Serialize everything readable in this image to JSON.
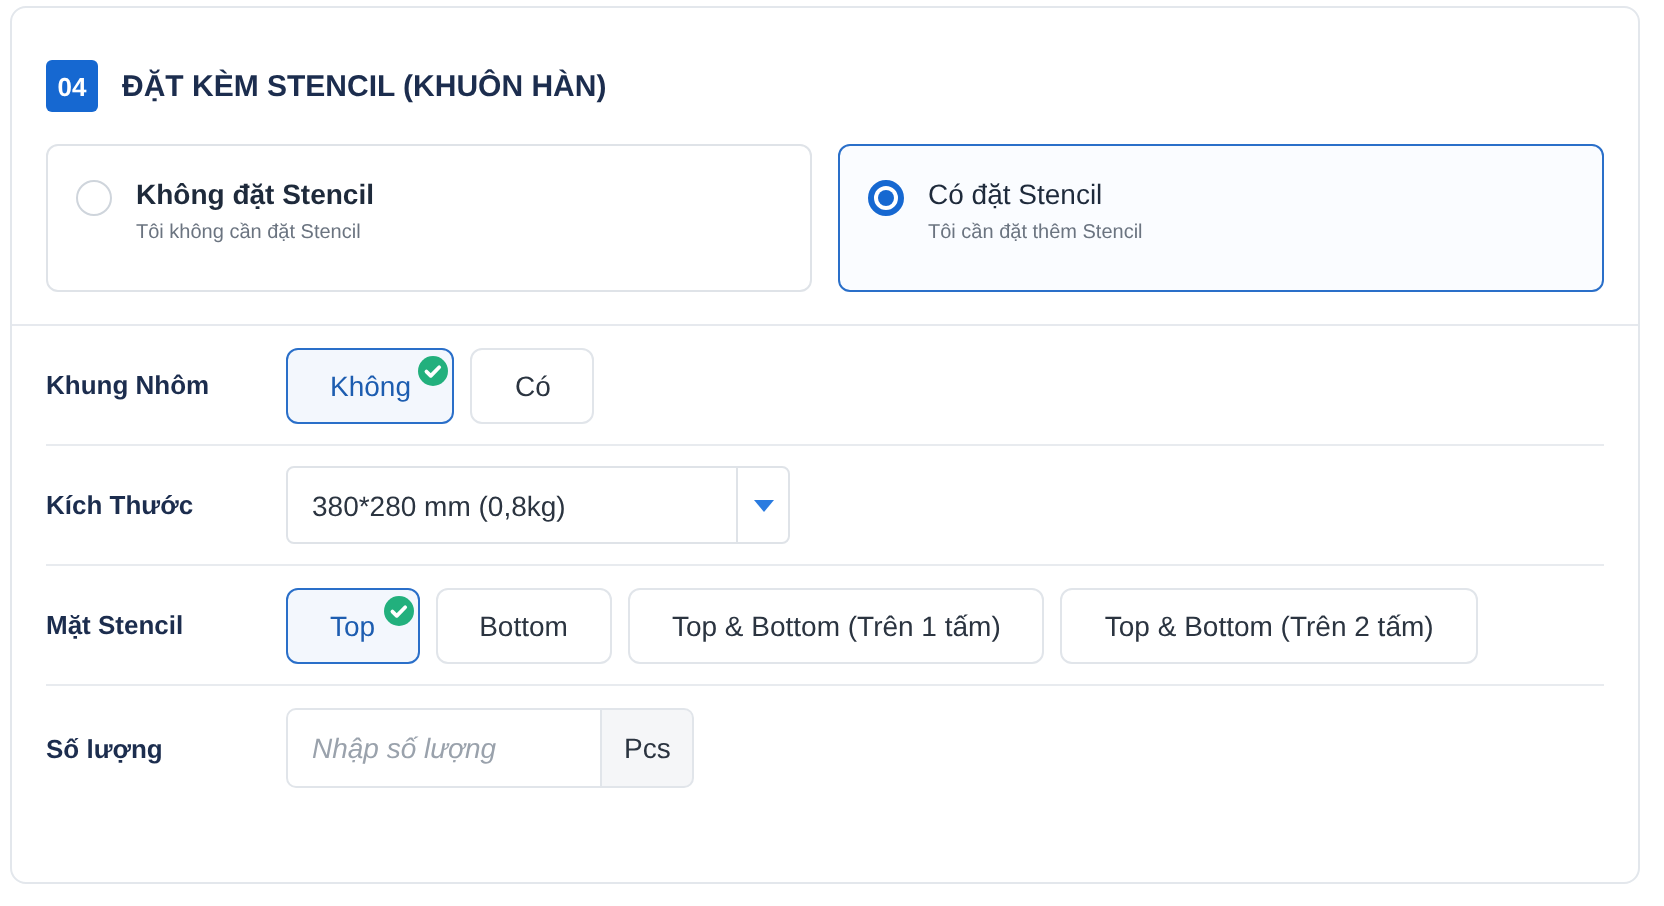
{
  "section": {
    "number": "04",
    "title": "ĐẶT KÈM STENCIL (KHUÔN HÀN)"
  },
  "order_options": [
    {
      "title": "Không đặt Stencil",
      "subtitle": "Tôi không cần đặt Stencil",
      "selected": false
    },
    {
      "title": "Có đặt Stencil",
      "subtitle": "Tôi cần đặt thêm Stencil",
      "selected": true
    }
  ],
  "fields": [
    {
      "kind": "choices",
      "label": "Khung Nhôm",
      "options": [
        {
          "label": "Không",
          "selected": true
        },
        {
          "label": "Có",
          "selected": false
        }
      ]
    },
    {
      "kind": "select",
      "label": "Kích Thước",
      "value": "380*280 mm (0,8kg)"
    },
    {
      "kind": "choices",
      "label": "Mặt Stencil",
      "options": [
        {
          "label": "Top",
          "selected": true
        },
        {
          "label": "Bottom",
          "selected": false
        },
        {
          "label": "Top & Bottom (Trên 1 tấm)",
          "selected": false
        },
        {
          "label": "Top & Bottom (Trên 2 tấm)",
          "selected": false
        }
      ]
    },
    {
      "kind": "number",
      "label": "Số lượng",
      "placeholder": "Nhập số lượng",
      "unit": "Pcs"
    }
  ]
}
